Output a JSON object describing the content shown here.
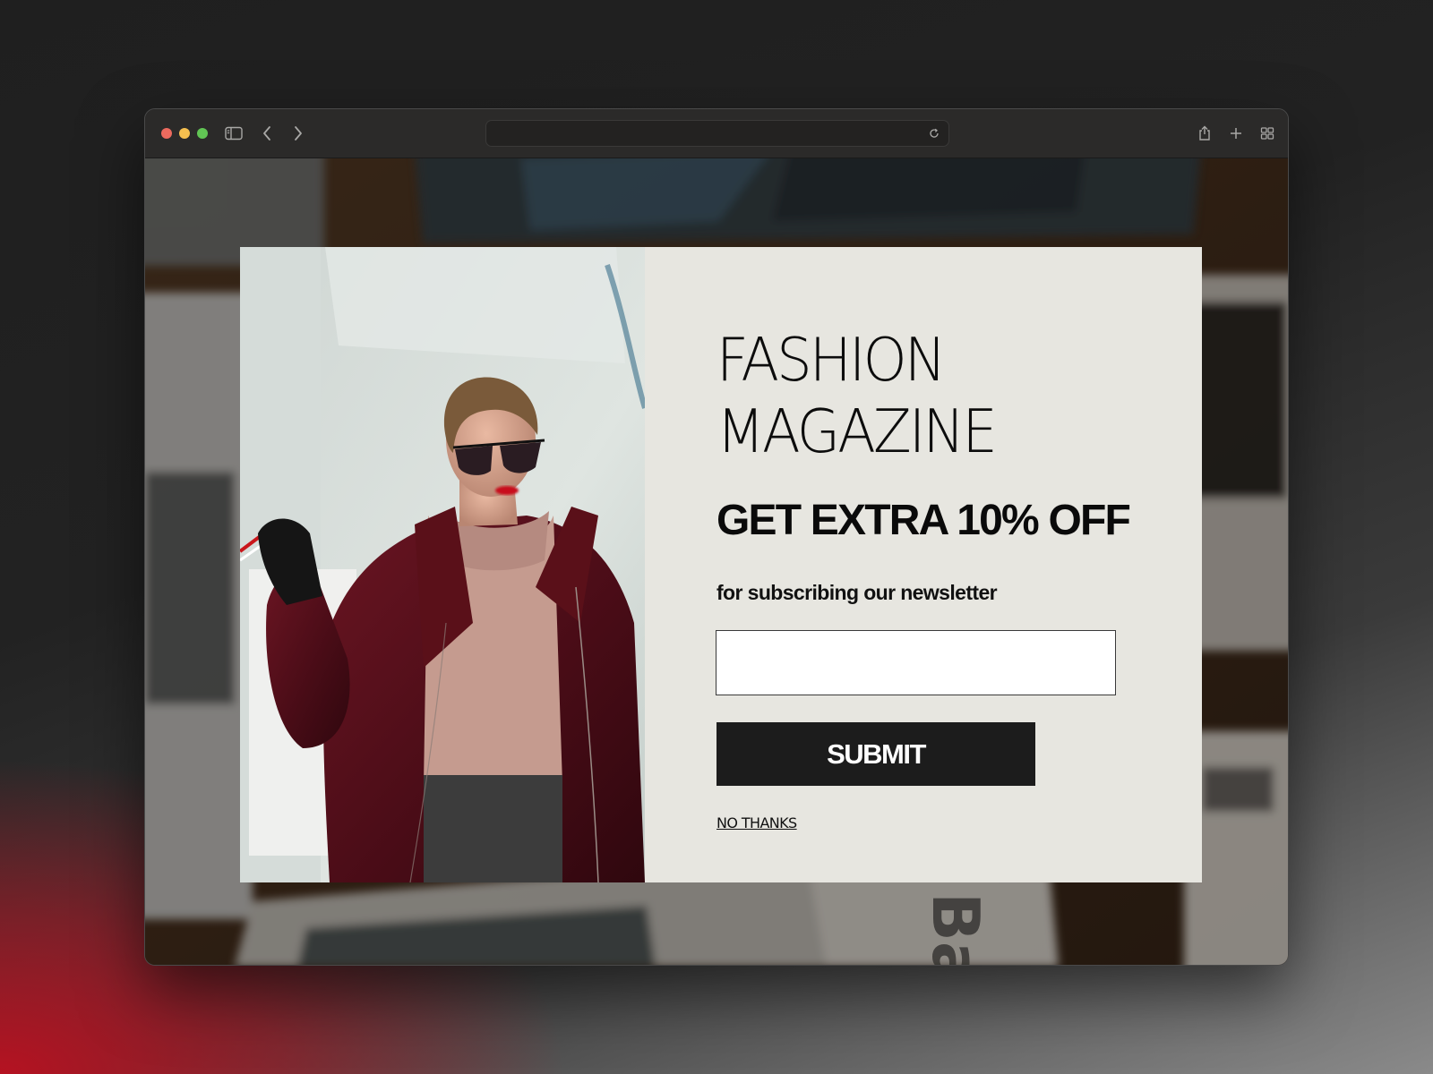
{
  "browser": {
    "traffic_lights": {
      "close": "#ed6a5e",
      "minimize": "#f5bf4f",
      "zoom": "#61c554"
    },
    "toolbar_icons": [
      "sidebar-icon",
      "back-chevron-icon",
      "forward-chevron-icon",
      "reload-icon",
      "share-icon",
      "new-tab-plus-icon",
      "tab-overview-icon"
    ],
    "address_value": ""
  },
  "popup": {
    "heading_line1": "FASHION",
    "heading_line2": "MAGAZINE",
    "offer": "GET EXTRA 10% OFF",
    "subtitle": "for subscribing our newsletter",
    "email_value": "",
    "email_placeholder": "",
    "submit_label": "SUBMIT",
    "decline_label": "NO THANKS",
    "colors": {
      "panel_bg": "#e7e6e0",
      "button_bg": "#1c1c1c",
      "button_text": "#ffffff",
      "text": "#0c0c0c"
    }
  },
  "background": {
    "visible_text": "Ba"
  }
}
